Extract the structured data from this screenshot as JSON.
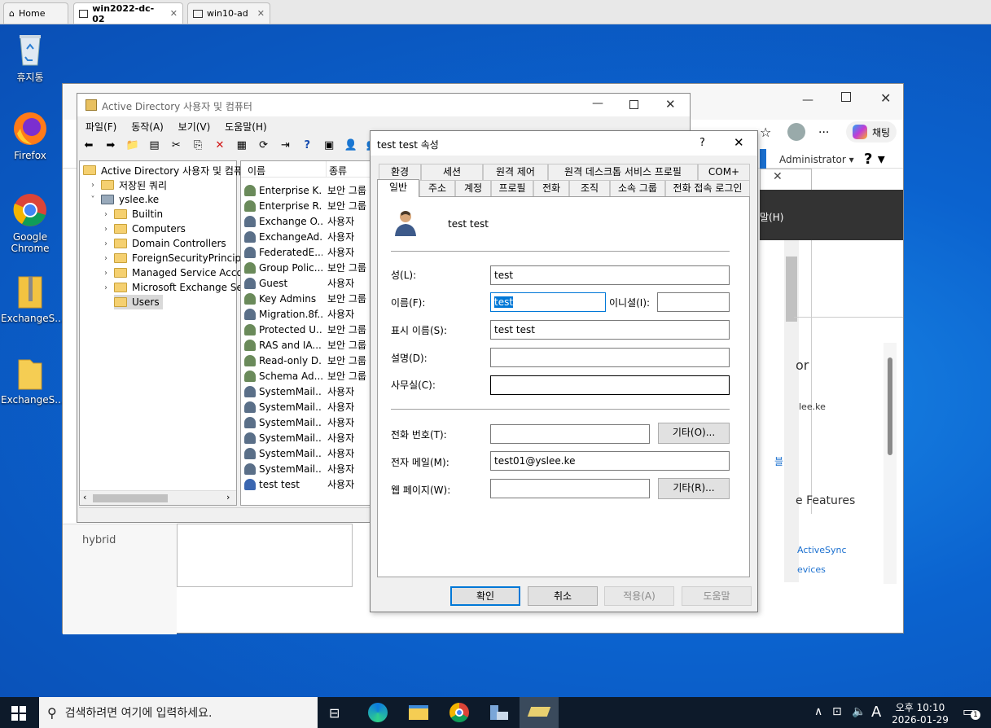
{
  "vm_tabs": [
    {
      "label": "Home"
    },
    {
      "label": "win2022-dc-02"
    },
    {
      "label": "win10-ad"
    }
  ],
  "desktop_icons": [
    {
      "label": "휴지통"
    },
    {
      "label": "Firefox"
    },
    {
      "label": "Google Chrome"
    },
    {
      "label": "ExchangeS..."
    },
    {
      "label": "ExchangeS..."
    }
  ],
  "browser": {
    "chat_label": "채팅",
    "account": "Administrator",
    "help": "?",
    "frag_menu": "말(H)",
    "frag_or": "or",
    "frag_domain": "lee.ke",
    "frag_features": "e Features",
    "frag_activesync": "ActiveSync",
    "frag_devices": "evices",
    "hybrid": "hybrid"
  },
  "ad_window": {
    "title": "Active Directory 사용자 및 컴퓨터",
    "menu": [
      "파일(F)",
      "동작(A)",
      "보기(V)",
      "도움말(H)"
    ],
    "tree": {
      "root": "Active Directory 사용자 및 컴퓨",
      "saved_queries": "저장된 쿼리",
      "domain": "yslee.ke",
      "children": [
        "Builtin",
        "Computers",
        "Domain Controllers",
        "ForeignSecurityPrincipal",
        "Managed Service Accou",
        "Microsoft Exchange Sec",
        "Users"
      ]
    },
    "list": {
      "col_name": "이름",
      "col_type": "종류",
      "rows": [
        {
          "name": "Enterprise K...",
          "type": "보안 그룹"
        },
        {
          "name": "Enterprise R...",
          "type": "보안 그룹"
        },
        {
          "name": "Exchange O...",
          "type": "사용자"
        },
        {
          "name": "ExchangeAd...",
          "type": "사용자"
        },
        {
          "name": "FederatedE...",
          "type": "사용자"
        },
        {
          "name": "Group Polic...",
          "type": "보안 그룹"
        },
        {
          "name": "Guest",
          "type": "사용자"
        },
        {
          "name": "Key Admins",
          "type": "보안 그룹"
        },
        {
          "name": "Migration.8f...",
          "type": "사용자"
        },
        {
          "name": "Protected U...",
          "type": "보안 그룹"
        },
        {
          "name": "RAS and IA...",
          "type": "보안 그룹"
        },
        {
          "name": "Read-only D...",
          "type": "보안 그룹"
        },
        {
          "name": "Schema Ad...",
          "type": "보안 그룹"
        },
        {
          "name": "SystemMail...",
          "type": "사용자"
        },
        {
          "name": "SystemMail...",
          "type": "사용자"
        },
        {
          "name": "SystemMail...",
          "type": "사용자"
        },
        {
          "name": "SystemMail...",
          "type": "사용자"
        },
        {
          "name": "SystemMail...",
          "type": "사용자"
        },
        {
          "name": "SystemMail...",
          "type": "사용자"
        },
        {
          "name": "test test",
          "type": "사용자"
        }
      ]
    }
  },
  "dialog": {
    "title": "test test 속성",
    "help": "?",
    "tabs_row1": [
      "환경",
      "세션",
      "원격 제어",
      "원격 데스크톱 서비스 프로필",
      "COM+"
    ],
    "tabs_row2": [
      "일반",
      "주소",
      "계정",
      "프로필",
      "전화",
      "조직",
      "소속 그룹",
      "전화 접속 로그인"
    ],
    "user_display": "test test",
    "fields": {
      "last_name_label": "성(L):",
      "last_name": "test",
      "first_name_label": "이름(F):",
      "first_name": "test",
      "initials_label": "이니셜(I):",
      "initials": "",
      "display_name_label": "표시 이름(S):",
      "display_name": "test test",
      "description_label": "설명(D):",
      "description": "",
      "office_label": "사무실(C):",
      "office": "",
      "phone_label": "전화 번호(T):",
      "phone": "",
      "phone_other": "기타(O)...",
      "email_label": "전자 메일(M):",
      "email": "test01@yslee.ke",
      "web_label": "웹 페이지(W):",
      "web": "",
      "web_other": "기타(R)..."
    },
    "buttons": {
      "ok": "확인",
      "cancel": "취소",
      "apply": "적용(A)",
      "help": "도움말"
    }
  },
  "taskbar": {
    "search_placeholder": "검색하려면 여기에 입력하세요.",
    "time": "오후 10:10",
    "date": "2026-01-29",
    "ime": "A",
    "notification_count": "1"
  }
}
